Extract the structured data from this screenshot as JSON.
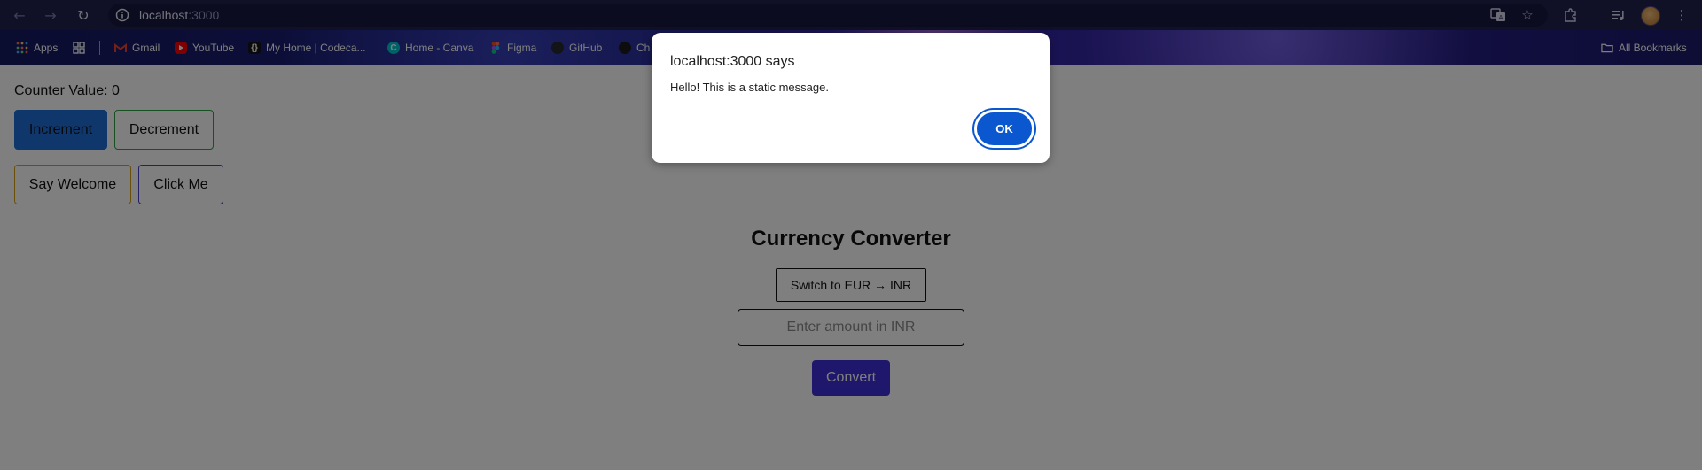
{
  "browser": {
    "url_host": "localhost",
    "url_port": ":3000",
    "bookmarks": [
      {
        "label": "Apps"
      },
      {
        "label": "Gmail"
      },
      {
        "label": "YouTube"
      },
      {
        "label": "My Home | Codeca..."
      },
      {
        "label": "Home - Canva"
      },
      {
        "label": "Figma"
      },
      {
        "label": "GitHub"
      },
      {
        "label": "Ch"
      }
    ],
    "all_bookmarks_label": "All Bookmarks"
  },
  "page": {
    "counter_label": "Counter Value: 0",
    "increment_label": "Increment",
    "decrement_label": "Decrement",
    "say_welcome_label": "Say Welcome",
    "click_me_label": "Click Me",
    "converter": {
      "title": "Currency Converter",
      "switch_label": "Switch to EUR → INR",
      "amount_placeholder": "Enter amount in INR",
      "convert_label": "Convert"
    }
  },
  "dialog": {
    "title": "localhost:3000 says",
    "message": "Hello! This is a static message.",
    "ok_label": "OK"
  },
  "colors": {
    "increment_bg": "#1e6fd9",
    "decrement_border": "#2ea043",
    "say_welcome_border": "#d4a017",
    "click_me_border": "#4b3fc7",
    "convert_bg": "#3f2fd6",
    "dialog_ok": "#0b57d0"
  }
}
